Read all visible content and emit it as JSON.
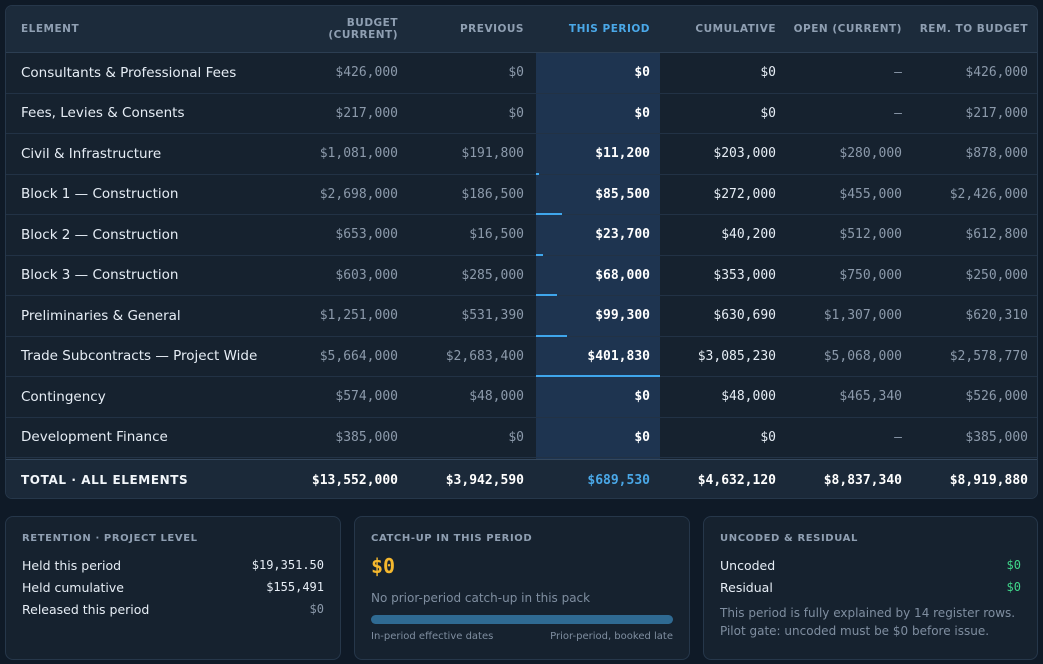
{
  "table": {
    "headers": {
      "element": "ELEMENT",
      "budget_line1": "BUDGET",
      "budget_line2": "(CURRENT)",
      "previous": "PREVIOUS",
      "this_period": "THIS PERIOD",
      "cumulative": "CUMULATIVE",
      "open": "OPEN (CURRENT)",
      "remaining": "REM. TO BUDGET"
    },
    "rows": [
      {
        "element": "Consultants & Professional Fees",
        "budget": "$426,000",
        "previous": "$0",
        "this_period": "$0",
        "cumulative": "$0",
        "open": "—",
        "remaining": "$426,000",
        "period_share": 0
      },
      {
        "element": "Fees, Levies & Consents",
        "budget": "$217,000",
        "previous": "$0",
        "this_period": "$0",
        "cumulative": "$0",
        "open": "—",
        "remaining": "$217,000",
        "period_share": 0
      },
      {
        "element": "Civil & Infrastructure",
        "budget": "$1,081,000",
        "previous": "$191,800",
        "this_period": "$11,200",
        "cumulative": "$203,000",
        "open": "$280,000",
        "remaining": "$878,000",
        "period_share": 0.028
      },
      {
        "element": "Block 1 — Construction",
        "budget": "$2,698,000",
        "previous": "$186,500",
        "this_period": "$85,500",
        "cumulative": "$272,000",
        "open": "$455,000",
        "remaining": "$2,426,000",
        "period_share": 0.213
      },
      {
        "element": "Block 2 — Construction",
        "budget": "$653,000",
        "previous": "$16,500",
        "this_period": "$23,700",
        "cumulative": "$40,200",
        "open": "$512,000",
        "remaining": "$612,800",
        "period_share": 0.059
      },
      {
        "element": "Block 3 — Construction",
        "budget": "$603,000",
        "previous": "$285,000",
        "this_period": "$68,000",
        "cumulative": "$353,000",
        "open": "$750,000",
        "remaining": "$250,000",
        "period_share": 0.169
      },
      {
        "element": "Preliminaries & General",
        "budget": "$1,251,000",
        "previous": "$531,390",
        "this_period": "$99,300",
        "cumulative": "$630,690",
        "open": "$1,307,000",
        "remaining": "$620,310",
        "period_share": 0.247
      },
      {
        "element": "Trade Subcontracts — Project Wide",
        "budget": "$5,664,000",
        "previous": "$2,683,400",
        "this_period": "$401,830",
        "cumulative": "$3,085,230",
        "open": "$5,068,000",
        "remaining": "$2,578,770",
        "period_share": 1.0
      },
      {
        "element": "Contingency",
        "budget": "$574,000",
        "previous": "$48,000",
        "this_period": "$0",
        "cumulative": "$48,000",
        "open": "$465,340",
        "remaining": "$526,000",
        "period_share": 0
      },
      {
        "element": "Development Finance",
        "budget": "$385,000",
        "previous": "$0",
        "this_period": "$0",
        "cumulative": "$0",
        "open": "—",
        "remaining": "$385,000",
        "period_share": 0
      }
    ],
    "total": {
      "label": "TOTAL · ALL ELEMENTS",
      "budget": "$13,552,000",
      "previous": "$3,942,590",
      "this_period": "$689,530",
      "cumulative": "$4,632,120",
      "open": "$8,837,340",
      "remaining": "$8,919,880"
    }
  },
  "retention": {
    "title": "RETENTION · PROJECT LEVEL",
    "items": [
      {
        "label": "Held this period",
        "value": "$19,351.50"
      },
      {
        "label": "Held cumulative",
        "value": "$155,491"
      },
      {
        "label": "Released this period",
        "value": "$0"
      }
    ]
  },
  "catchup": {
    "title": "CATCH-UP IN THIS PERIOD",
    "amount": "$0",
    "note": "No prior-period catch-up in this pack",
    "progress_fraction": 1.0,
    "legend_left": "In-period effective dates",
    "legend_right": "Prior-period, booked late"
  },
  "uncoded": {
    "title": "UNCODED & RESIDUAL",
    "items": [
      {
        "label": "Uncoded",
        "value": "$0"
      },
      {
        "label": "Residual",
        "value": "$0"
      }
    ],
    "explanation_line1": "This period is fully explained by 14 register rows.",
    "explanation_line2": "Pilot gate: uncoded must be $0 before issue."
  },
  "colors": {
    "accent": "#4aa8e8",
    "period_bar": "#3fa6ec",
    "catchup_amount": "#f5b82e",
    "positive": "#3fd68a"
  }
}
